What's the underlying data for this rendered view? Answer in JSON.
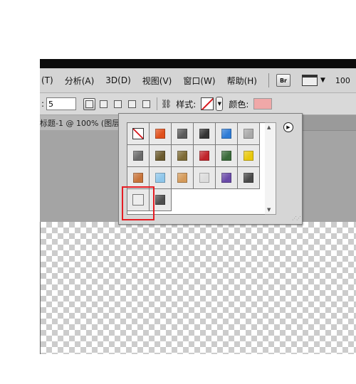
{
  "menubar": {
    "items": [
      "(T)",
      "分析(A)",
      "3D(D)",
      "视图(V)",
      "窗口(W)",
      "帮助(H)"
    ],
    "br_label": "Br",
    "zoom": "100"
  },
  "options": {
    "width_label": ":",
    "width_value": "5",
    "style_label": "样式:",
    "color_label": "颜色:",
    "color_value": "#f0a8a8"
  },
  "document": {
    "tab_title": "标题-1 @ 100% (图层"
  },
  "style_picker": {
    "styles": [
      {
        "name": "none",
        "color": "#ffffff"
      },
      {
        "name": "red-orange-glow",
        "color": "#e0501c"
      },
      {
        "name": "dark-grey-square",
        "color": "#5a5a5a"
      },
      {
        "name": "black-chrome",
        "color": "#333333"
      },
      {
        "name": "blue-glass",
        "color": "#2f7cd6"
      },
      {
        "name": "light-grey",
        "color": "#a9a9a9"
      },
      {
        "name": "steel-gradient",
        "color": "#6a6a6a"
      },
      {
        "name": "brown-satin",
        "color": "#6b5a2e"
      },
      {
        "name": "olive-brown",
        "color": "#7d6a35"
      },
      {
        "name": "red-stripe",
        "color": "#c0242a"
      },
      {
        "name": "multicolor",
        "color": "#3a6a3a"
      },
      {
        "name": "yellow-bevel",
        "color": "#e8c80c"
      },
      {
        "name": "copper-orange",
        "color": "#c8743a"
      },
      {
        "name": "sky-blue",
        "color": "#8ec6ea"
      },
      {
        "name": "sunset-sky",
        "color": "#d49a5a"
      },
      {
        "name": "white-pattern",
        "color": "#dcdcdc"
      },
      {
        "name": "purple-blue",
        "color": "#6a4aa8"
      },
      {
        "name": "charcoal",
        "color": "#4a4a4a"
      },
      {
        "name": "blank-outline",
        "color": "#e9e9e9"
      },
      {
        "name": "dark-grey-solid",
        "color": "#4e4e4e"
      }
    ]
  }
}
